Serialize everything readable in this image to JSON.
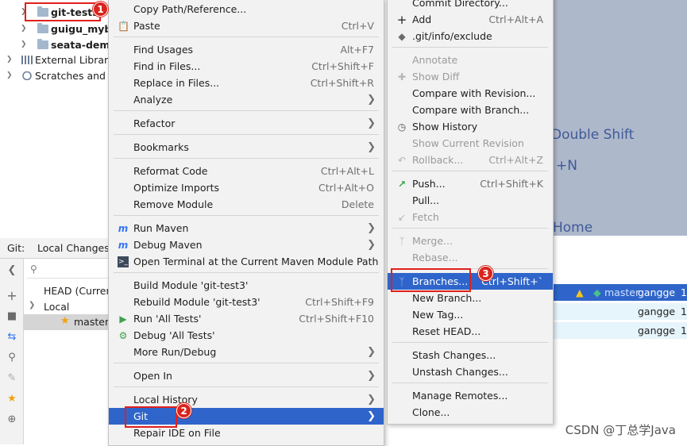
{
  "project_tree": {
    "items": [
      {
        "label": "git-test3",
        "bold": true
      },
      {
        "label": "guigu_myba",
        "bold": true
      },
      {
        "label": "seata-demo",
        "bold": true
      },
      {
        "label": "External Librarie",
        "bold": false
      },
      {
        "label": "Scratches and C",
        "bold": false
      }
    ]
  },
  "welcome": {
    "hints": [
      "Double Shift",
      "+N",
      "Home"
    ]
  },
  "git_panel": {
    "tab_git": "Git:",
    "tab_local_changes": "Local Changes",
    "branches": {
      "head": "HEAD (Curren",
      "local": "Local",
      "master": "master"
    },
    "log_rows": [
      {
        "tag": "master",
        "author": "gangge",
        "num": "1"
      },
      {
        "author": "gangge",
        "num": "1"
      },
      {
        "author": "gangge",
        "num": "1"
      }
    ]
  },
  "context_menu": {
    "items": [
      {
        "label": "Copy Path/Reference...",
        "shortcut": ""
      },
      {
        "label": "Paste",
        "shortcut": "Ctrl+V",
        "icon": "paste-icon"
      },
      {
        "label": "Find Usages",
        "shortcut": "Alt+F7"
      },
      {
        "label": "Find in Files...",
        "shortcut": "Ctrl+Shift+F"
      },
      {
        "label": "Replace in Files...",
        "shortcut": "Ctrl+Shift+R"
      },
      {
        "label": "Analyze",
        "submenu": true
      },
      {
        "label": "Refactor",
        "submenu": true
      },
      {
        "label": "Bookmarks",
        "submenu": true
      },
      {
        "label": "Reformat Code",
        "shortcut": "Ctrl+Alt+L"
      },
      {
        "label": "Optimize Imports",
        "shortcut": "Ctrl+Alt+O"
      },
      {
        "label": "Remove Module",
        "shortcut": "Delete"
      },
      {
        "label": "Run Maven",
        "submenu": true,
        "icon": "maven-icon"
      },
      {
        "label": "Debug Maven",
        "submenu": true,
        "icon": "maven-icon"
      },
      {
        "label": "Open Terminal at the Current Maven Module Path",
        "icon": "terminal-icon"
      },
      {
        "label": "Build Module 'git-test3'",
        "shortcut": ""
      },
      {
        "label": "Rebuild Module 'git-test3'",
        "shortcut": "Ctrl+Shift+F9"
      },
      {
        "label": "Run 'All Tests'",
        "shortcut": "Ctrl+Shift+F10",
        "icon": "run-icon"
      },
      {
        "label": "Debug 'All Tests'",
        "icon": "debug-icon"
      },
      {
        "label": "More Run/Debug",
        "submenu": true
      },
      {
        "label": "Open In",
        "submenu": true
      },
      {
        "label": "Local History",
        "submenu": true
      },
      {
        "label": "Git",
        "submenu": true
      },
      {
        "label": "Repair IDE on File"
      }
    ]
  },
  "git_submenu": {
    "items": [
      {
        "label": "Commit Directory..."
      },
      {
        "label": "Add",
        "shortcut": "Ctrl+Alt+A",
        "icon": "plus-icon"
      },
      {
        "label": ".git/info/exclude",
        "icon": "git-icon"
      },
      {
        "label": "Annotate",
        "disabled": true
      },
      {
        "label": "Show Diff",
        "disabled": true,
        "icon": "diff-icon"
      },
      {
        "label": "Compare with Revision..."
      },
      {
        "label": "Compare with Branch..."
      },
      {
        "label": "Show History",
        "icon": "clock-icon"
      },
      {
        "label": "Show Current Revision",
        "disabled": true
      },
      {
        "label": "Rollback...",
        "shortcut": "Ctrl+Alt+Z",
        "disabled": true,
        "icon": "rollback-icon"
      },
      {
        "label": "Push...",
        "shortcut": "Ctrl+Shift+K",
        "icon": "push-icon"
      },
      {
        "label": "Pull..."
      },
      {
        "label": "Fetch",
        "disabled": true,
        "icon": "fetch-icon"
      },
      {
        "label": "Merge...",
        "disabled": true,
        "icon": "merge-icon"
      },
      {
        "label": "Rebase...",
        "disabled": true
      },
      {
        "label": "Branches...",
        "shortcut": "Ctrl+Shift+`",
        "icon": "branch-icon"
      },
      {
        "label": "New Branch..."
      },
      {
        "label": "New Tag..."
      },
      {
        "label": "Reset HEAD..."
      },
      {
        "label": "Stash Changes..."
      },
      {
        "label": "Unstash Changes..."
      },
      {
        "label": "Manage Remotes..."
      },
      {
        "label": "Clone..."
      }
    ]
  },
  "annotations": {
    "badge1": "1",
    "badge2": "2",
    "badge3": "3"
  },
  "watermark": "CSDN @丁总学Java",
  "colors": {
    "menu_bg": "#f2f2f2",
    "selection": "#2f65ca",
    "annotation_red": "#e0201b",
    "welcome_bg": "#aeb8cb",
    "hint_text": "#3f5a98"
  }
}
